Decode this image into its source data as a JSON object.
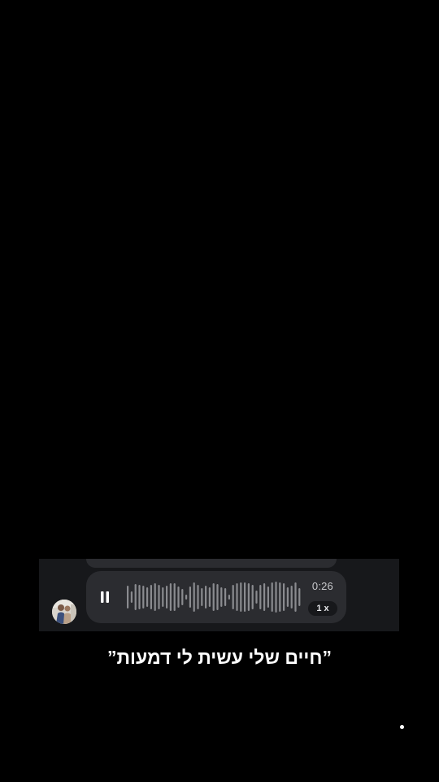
{
  "voice_message": {
    "duration": "0:26",
    "speed": "1 x",
    "playback_state": "playing",
    "play_control_icon": "pause-icon"
  },
  "caption": {
    "text": "”חיים שלי עשית לי דמעות”"
  },
  "colors": {
    "background": "#000000",
    "chat_strip": "#17181b",
    "bubble": "#2b2c30",
    "waveform": "#8a8b8f",
    "text_primary": "#ffffff"
  }
}
